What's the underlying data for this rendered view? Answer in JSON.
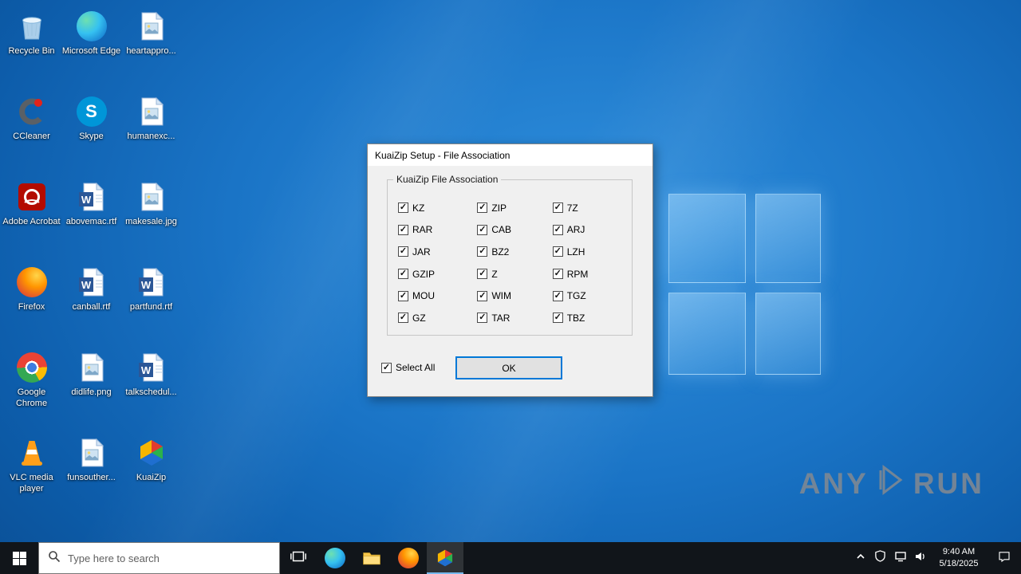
{
  "desktop": {
    "icons": [
      {
        "label": "Recycle Bin",
        "icon": "recycle-bin"
      },
      {
        "label": "Microsoft Edge",
        "icon": "edge"
      },
      {
        "label": "heartappro...",
        "icon": "image-doc"
      },
      {
        "label": "CCleaner",
        "icon": "ccleaner"
      },
      {
        "label": "Skype",
        "icon": "skype"
      },
      {
        "label": "humanexc...",
        "icon": "image-doc"
      },
      {
        "label": "Adobe Acrobat",
        "icon": "acrobat"
      },
      {
        "label": "abovemac.rtf",
        "icon": "word"
      },
      {
        "label": "makesale.jpg",
        "icon": "image-doc"
      },
      {
        "label": "Firefox",
        "icon": "firefox"
      },
      {
        "label": "canball.rtf",
        "icon": "word"
      },
      {
        "label": "partfund.rtf",
        "icon": "word"
      },
      {
        "label": "Google Chrome",
        "icon": "chrome"
      },
      {
        "label": "didlife.png",
        "icon": "image-doc"
      },
      {
        "label": "talkschedul...",
        "icon": "word"
      },
      {
        "label": "VLC media player",
        "icon": "vlc"
      },
      {
        "label": "funsouther...",
        "icon": "image-doc"
      },
      {
        "label": "KuaiZip",
        "icon": "kuaizip"
      }
    ]
  },
  "dialog": {
    "title": "KuaiZip Setup - File Association",
    "group_label": "KuaiZip File Association",
    "columns": [
      [
        {
          "label": "KZ",
          "checked": true
        },
        {
          "label": "RAR",
          "checked": true
        },
        {
          "label": "JAR",
          "checked": true
        },
        {
          "label": "GZIP",
          "checked": true
        },
        {
          "label": "MOU",
          "checked": true
        },
        {
          "label": "GZ",
          "checked": true
        }
      ],
      [
        {
          "label": "ZIP",
          "checked": true
        },
        {
          "label": "CAB",
          "checked": true
        },
        {
          "label": "BZ2",
          "checked": true
        },
        {
          "label": "Z",
          "checked": true
        },
        {
          "label": "WIM",
          "checked": true
        },
        {
          "label": "TAR",
          "checked": true
        }
      ],
      [
        {
          "label": "7Z",
          "checked": true
        },
        {
          "label": "ARJ",
          "checked": true
        },
        {
          "label": "LZH",
          "checked": true
        },
        {
          "label": "RPM",
          "checked": true
        },
        {
          "label": "TGZ",
          "checked": true
        },
        {
          "label": "TBZ",
          "checked": true
        }
      ]
    ],
    "select_all": {
      "label": "Select All",
      "checked": true
    },
    "ok_label": "OK"
  },
  "taskbar": {
    "search_placeholder": "Type here to search",
    "time": "9:40 AM",
    "date": "5/18/2025"
  },
  "watermark": {
    "left": "ANY",
    "right": "RUN"
  },
  "colors": {
    "accent": "#0078d7",
    "taskbar": "#11151a",
    "dialog_bg": "#f0f0f0"
  }
}
